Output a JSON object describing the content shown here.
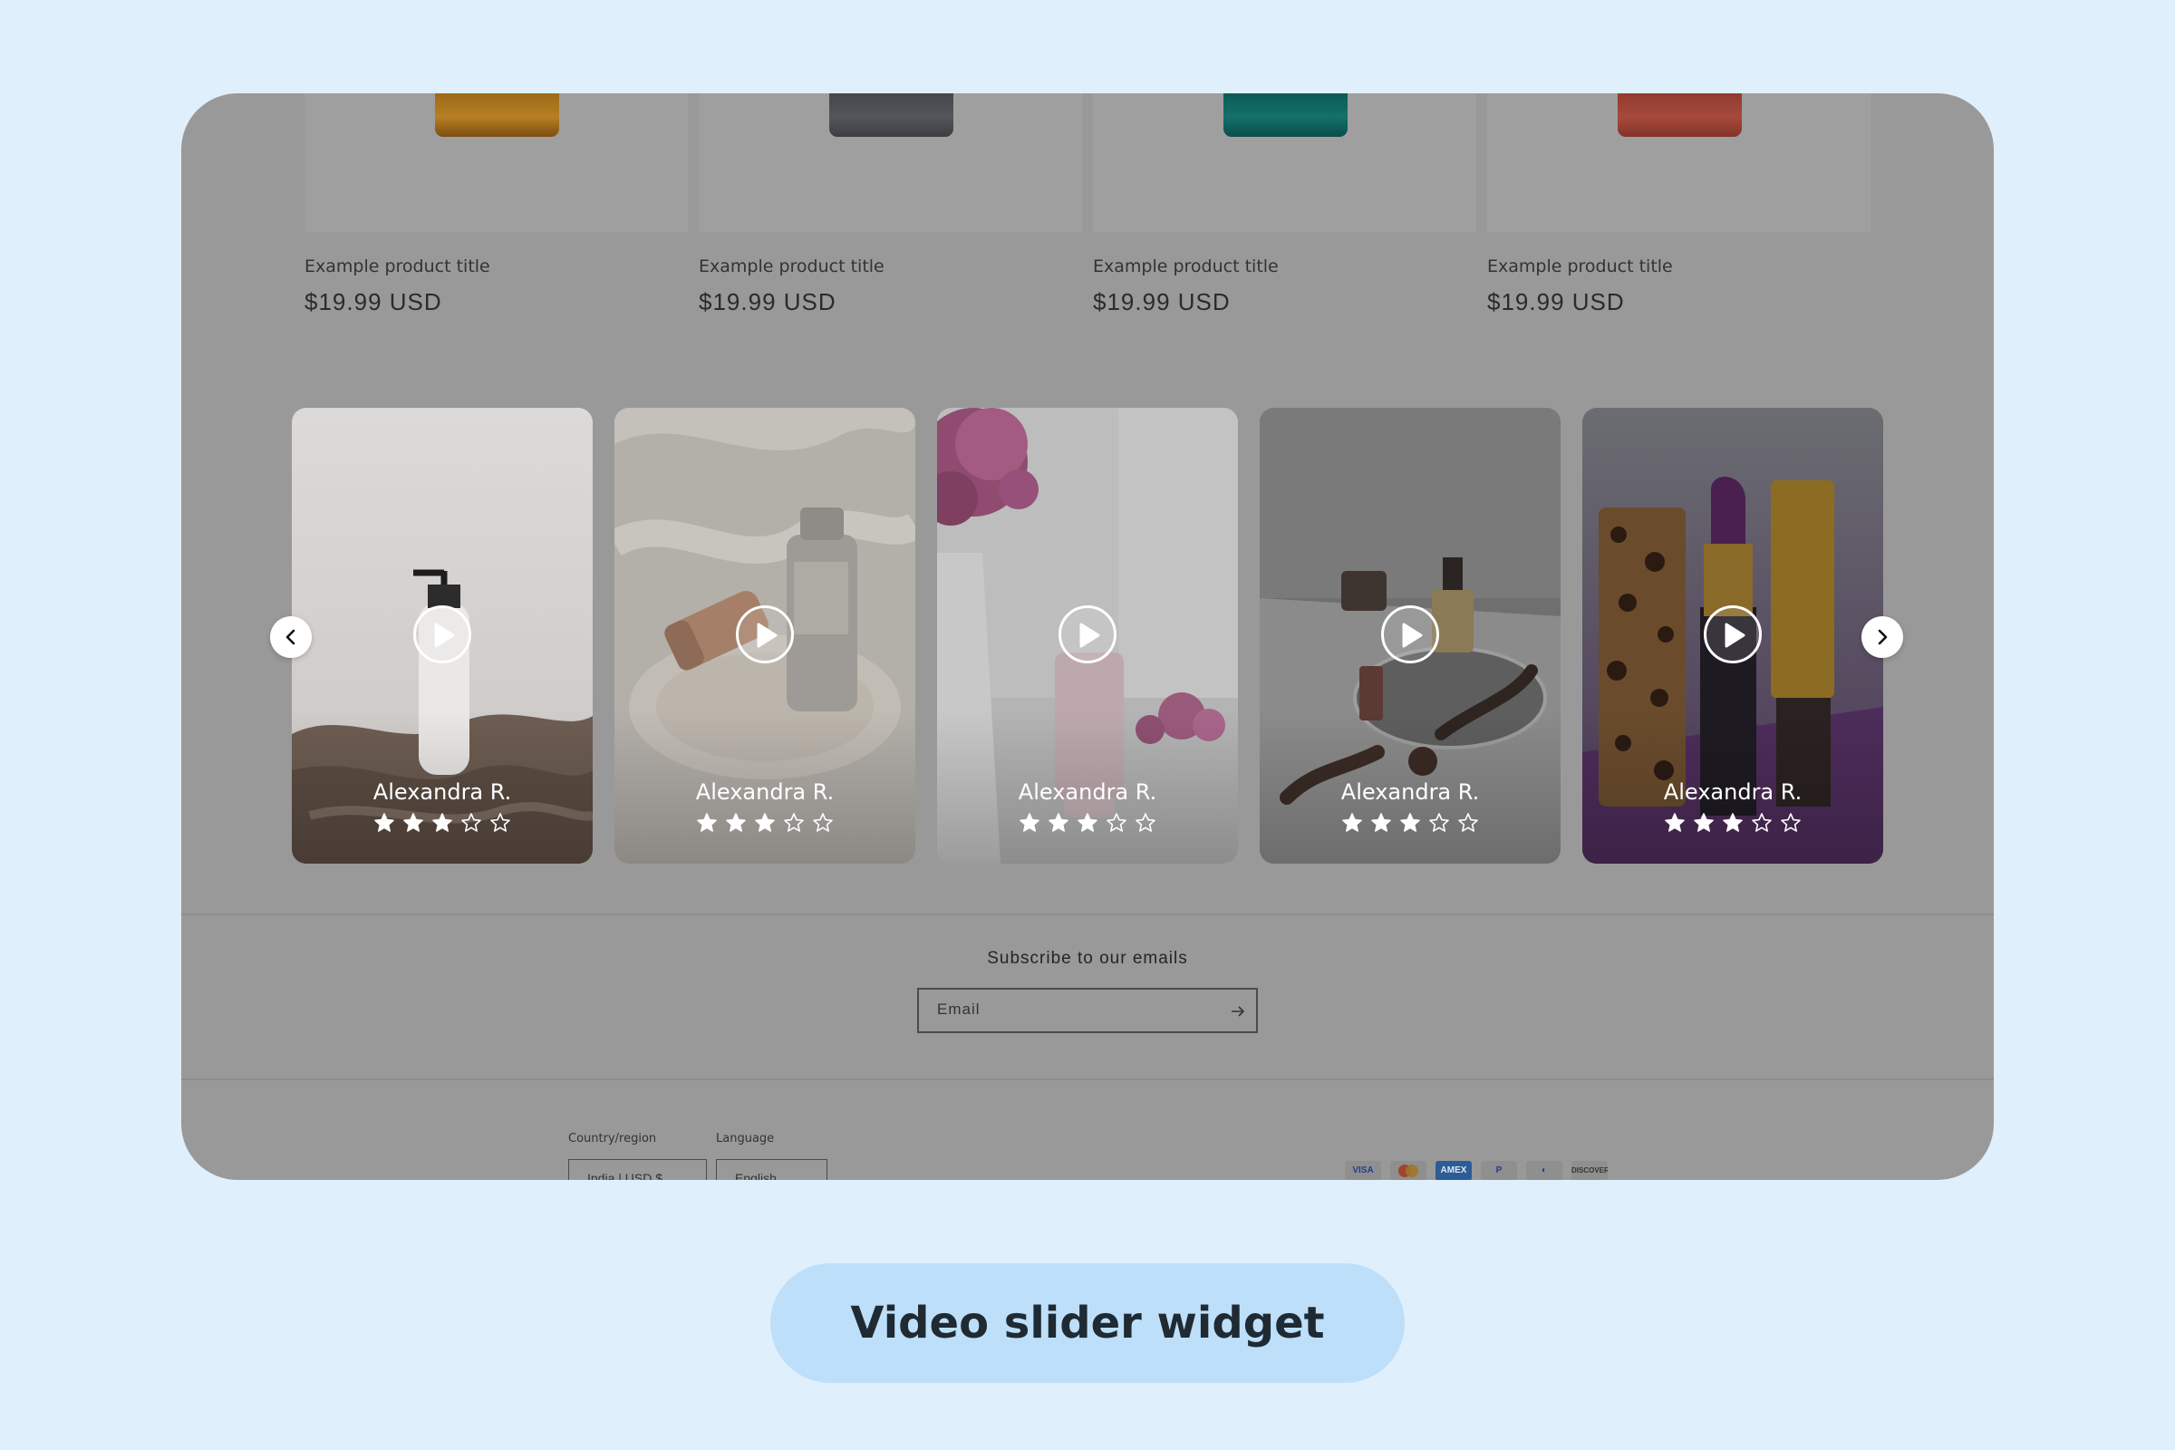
{
  "products": [
    {
      "title": "Example product title",
      "price": "$19.99 USD",
      "color": "#a0701c"
    },
    {
      "title": "Example product title",
      "price": "$19.99 USD",
      "color": "#4a4d52"
    },
    {
      "title": "Example product title",
      "price": "$19.99 USD",
      "color": "#0f6360"
    },
    {
      "title": "Example product title",
      "price": "$19.99 USD",
      "color": "#9c4337"
    }
  ],
  "slider": {
    "prev_icon": "chevron-left-icon",
    "next_icon": "chevron-right-icon",
    "cards": [
      {
        "reviewer": "Alexandra R.",
        "rating": 3,
        "max_rating": 5,
        "icon": "play-icon"
      },
      {
        "reviewer": "Alexandra R.",
        "rating": 3,
        "max_rating": 5,
        "icon": "play-icon"
      },
      {
        "reviewer": "Alexandra R.",
        "rating": 3,
        "max_rating": 5,
        "icon": "play-icon"
      },
      {
        "reviewer": "Alexandra R.",
        "rating": 3,
        "max_rating": 5,
        "icon": "play-icon"
      },
      {
        "reviewer": "Alexandra R.",
        "rating": 3,
        "max_rating": 5,
        "icon": "play-icon"
      }
    ]
  },
  "subscribe": {
    "title": "Subscribe to our emails",
    "email_placeholder": "Email",
    "submit_icon": "arrow-right-icon"
  },
  "footer": {
    "country_label": "Country/region",
    "country_value": "India | USD $",
    "language_label": "Language",
    "language_value": "English",
    "payment_methods": [
      "VISA",
      "Mastercard",
      "AMEX",
      "PayPal",
      "Diners",
      "DISCOVER"
    ]
  },
  "caption": "Video slider widget"
}
